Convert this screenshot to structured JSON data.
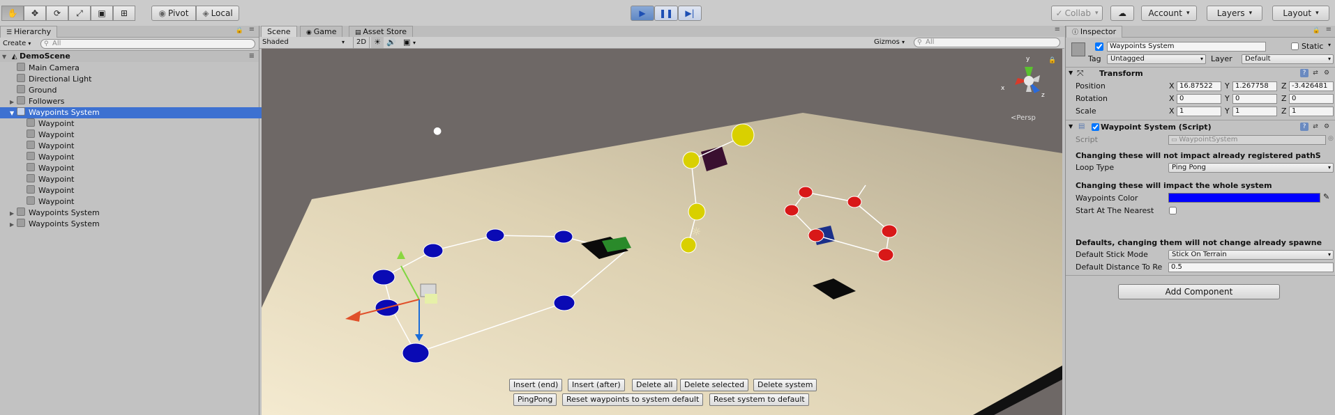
{
  "toolbar": {
    "tools": [
      "hand-tool",
      "move-tool",
      "rotate-tool",
      "scale-tool",
      "rect-tool",
      "transform-tool"
    ],
    "pivot_label": "Pivot",
    "local_label": "Local",
    "collab_label": "Collab",
    "account_label": "Account",
    "layers_label": "Layers",
    "layout_label": "Layout"
  },
  "hierarchy": {
    "tab_label": "Hierarchy",
    "create_label": "Create",
    "search_placeholder": "All",
    "scene_name": "DemoScene",
    "items": [
      {
        "label": "Main Camera"
      },
      {
        "label": "Directional Light"
      },
      {
        "label": "Ground"
      },
      {
        "label": "Followers"
      },
      {
        "label": "Waypoints System"
      },
      {
        "label": "Waypoint"
      },
      {
        "label": "Waypoint"
      },
      {
        "label": "Waypoint"
      },
      {
        "label": "Waypoint"
      },
      {
        "label": "Waypoint"
      },
      {
        "label": "Waypoint"
      },
      {
        "label": "Waypoint"
      },
      {
        "label": "Waypoint"
      },
      {
        "label": "Waypoints System"
      },
      {
        "label": "Waypoints System"
      }
    ]
  },
  "scene": {
    "tabs": [
      "Scene",
      "Game",
      "Asset Store"
    ],
    "shading_label": "Shaded",
    "mode_2d_label": "2D",
    "gizmos_label": "Gizmos",
    "search_placeholder": "All",
    "persp_label": "Persp",
    "gizmo_axes": {
      "x": "x",
      "y": "y",
      "z": "z"
    },
    "buttons_row1": [
      "Insert (end)",
      "Insert (after)",
      "Delete all",
      "Delete selected",
      "Delete system"
    ],
    "buttons_row2": [
      "PingPong",
      "Reset waypoints to system default",
      "Reset system to default"
    ]
  },
  "inspector": {
    "tab_label": "Inspector",
    "object_name": "Waypoints System",
    "static_label": "Static",
    "tag_label": "Tag",
    "tag_value": "Untagged",
    "layer_label": "Layer",
    "layer_value": "Default",
    "transform": {
      "header": "Transform",
      "position_label": "Position",
      "rotation_label": "Rotation",
      "scale_label": "Scale",
      "axis_x": "X",
      "axis_y": "Y",
      "axis_z": "Z",
      "position": [
        "16.87522",
        "1.267758",
        "-3.426481"
      ],
      "rotation": [
        "0",
        "0",
        "0"
      ],
      "scale": [
        "1",
        "1",
        "1"
      ]
    },
    "script_component": {
      "header": "Waypoint System (Script)",
      "script_label": "Script",
      "script_value": "WaypointSystem",
      "note1": "Changing these will not impact already registered pathS",
      "loop_type_label": "Loop Type",
      "loop_type_value": "Ping Pong",
      "note2": "Changing these will impact the whole system",
      "waypoints_color_label": "Waypoints Color",
      "waypoints_color": "#0000ff",
      "start_nearest_label": "Start At The Nearest",
      "note3": "Defaults, changing them will not change already spawne",
      "stick_mode_label": "Default Stick Mode",
      "stick_mode_value": "Stick On Terrain",
      "distance_label": "Default Distance To Re",
      "distance_value": "0.5"
    },
    "add_component_label": "Add Component"
  }
}
